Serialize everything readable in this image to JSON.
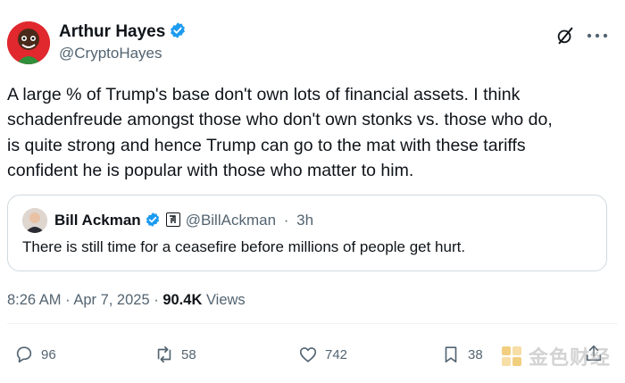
{
  "author": {
    "name": "Arthur Hayes",
    "handle": "@CryptoHayes"
  },
  "tweet": {
    "lines": [
      "A large % of Trump's base don't own lots of financial assets. I think",
      "schadenfreude amongst those who don't own stonks vs. those who do,",
      "is quite strong and hence Trump can go to the mat with these tariffs",
      "confident he is popular with those who matter to him."
    ]
  },
  "quote": {
    "name": "Bill Ackman",
    "handle": "@BillAckman",
    "separator": "·",
    "age": "3h",
    "text": "There is still time for a ceasefire before millions of people get hurt."
  },
  "meta": {
    "time": "8:26 AM",
    "sep1": "·",
    "date": "Apr 7, 2025",
    "sep2": "·",
    "views_count": "90.4K",
    "views_label": "Views"
  },
  "actions": {
    "replies": "96",
    "reposts": "58",
    "likes": "742",
    "bookmarks": "38"
  },
  "icons": {
    "verified": "verified-badge-icon",
    "grok": "grok-icon",
    "more": "more-icon",
    "reply": "reply-icon",
    "repost": "repost-icon",
    "like": "like-icon",
    "bookmark": "bookmark-icon",
    "share": "share-icon"
  },
  "colors": {
    "accent": "#1d9bf0",
    "text": "#0f1419",
    "secondary": "#536471",
    "border": "#cfd9de"
  },
  "watermark": {
    "text": "金色财经"
  }
}
